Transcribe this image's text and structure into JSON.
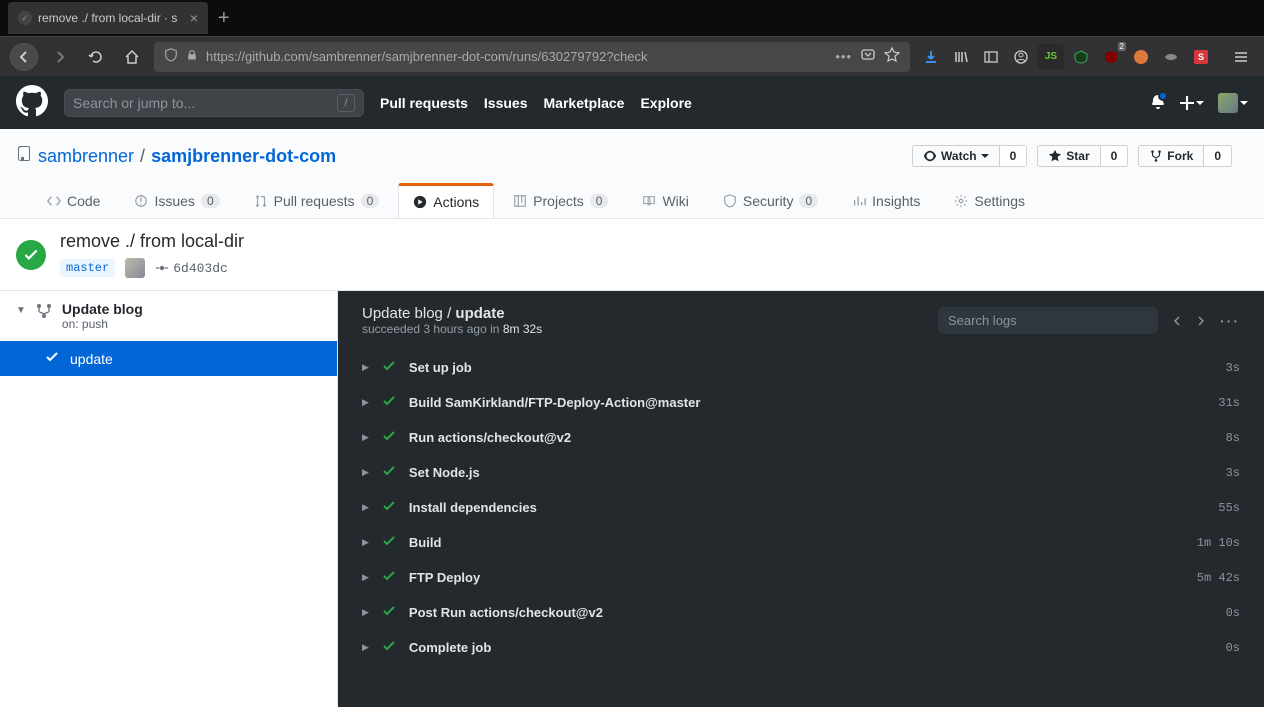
{
  "browser": {
    "tab_title": "remove ./ from local-dir · s",
    "url": "https://github.com/sambrenner/samjbrenner-dot-com/runs/630279792?check"
  },
  "github": {
    "search_placeholder": "Search or jump to...",
    "nav": {
      "pull_requests": "Pull requests",
      "issues": "Issues",
      "marketplace": "Marketplace",
      "explore": "Explore"
    }
  },
  "repo": {
    "owner": "sambrenner",
    "name": "samjbrenner-dot-com",
    "watch_label": "Watch",
    "watch_count": "0",
    "star_label": "Star",
    "star_count": "0",
    "fork_label": "Fork",
    "fork_count": "0",
    "tabs": {
      "code": "Code",
      "issues": "Issues",
      "issues_count": "0",
      "pr": "Pull requests",
      "pr_count": "0",
      "actions": "Actions",
      "projects": "Projects",
      "projects_count": "0",
      "wiki": "Wiki",
      "security": "Security",
      "security_count": "0",
      "insights": "Insights",
      "settings": "Settings"
    }
  },
  "run": {
    "title": "remove ./ from local-dir",
    "branch": "master",
    "sha": "6d403dc"
  },
  "sidebar": {
    "workflow_name": "Update blog",
    "trigger": "on: push",
    "job_name": "update"
  },
  "log": {
    "breadcrumb_workflow": "Update blog",
    "breadcrumb_job": "update",
    "status": "succeeded",
    "time_ago": "3 hours ago",
    "in_word": "in",
    "duration": "8m 32s",
    "search_placeholder": "Search logs",
    "steps": [
      {
        "name": "Set up job",
        "duration": "3s"
      },
      {
        "name": "Build SamKirkland/FTP-Deploy-Action@master",
        "duration": "31s"
      },
      {
        "name": "Run actions/checkout@v2",
        "duration": "8s"
      },
      {
        "name": "Set Node.js",
        "duration": "3s"
      },
      {
        "name": "Install dependencies",
        "duration": "55s"
      },
      {
        "name": "Build",
        "duration": "1m 10s"
      },
      {
        "name": "FTP Deploy",
        "duration": "5m 42s"
      },
      {
        "name": "Post Run actions/checkout@v2",
        "duration": "0s"
      },
      {
        "name": "Complete job",
        "duration": "0s"
      }
    ]
  }
}
